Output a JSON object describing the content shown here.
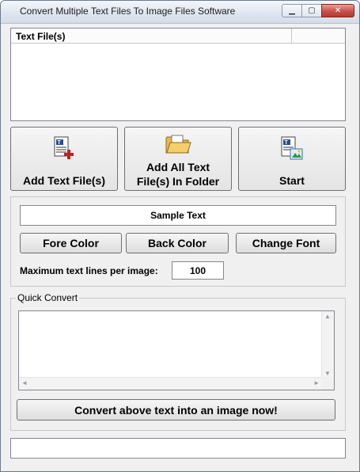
{
  "window": {
    "title": "Convert Multiple Text Files To Image Files Software",
    "minimize_glyph": "▁",
    "maximize_glyph": "▢",
    "close_glyph": "✕"
  },
  "file_list": {
    "columns": [
      "Text File(s)",
      ""
    ]
  },
  "actions": {
    "add_files": "Add Text File(s)",
    "add_folder_line1": "Add All Text",
    "add_folder_line2": "File(s) In Folder",
    "start": "Start"
  },
  "settings": {
    "sample_text": "Sample Text",
    "fore_color": "Fore Color",
    "back_color": "Back Color",
    "change_font": "Change Font",
    "max_lines_label": "Maximum text lines per image:",
    "max_lines_value": "100"
  },
  "quick_convert": {
    "title": "Quick Convert",
    "text_value": "",
    "convert_button": "Convert above text into an image now!"
  },
  "status_bar": {
    "text": ""
  },
  "colors": {
    "window_bg": "#f0f0f0",
    "accent_close": "#c75050"
  }
}
